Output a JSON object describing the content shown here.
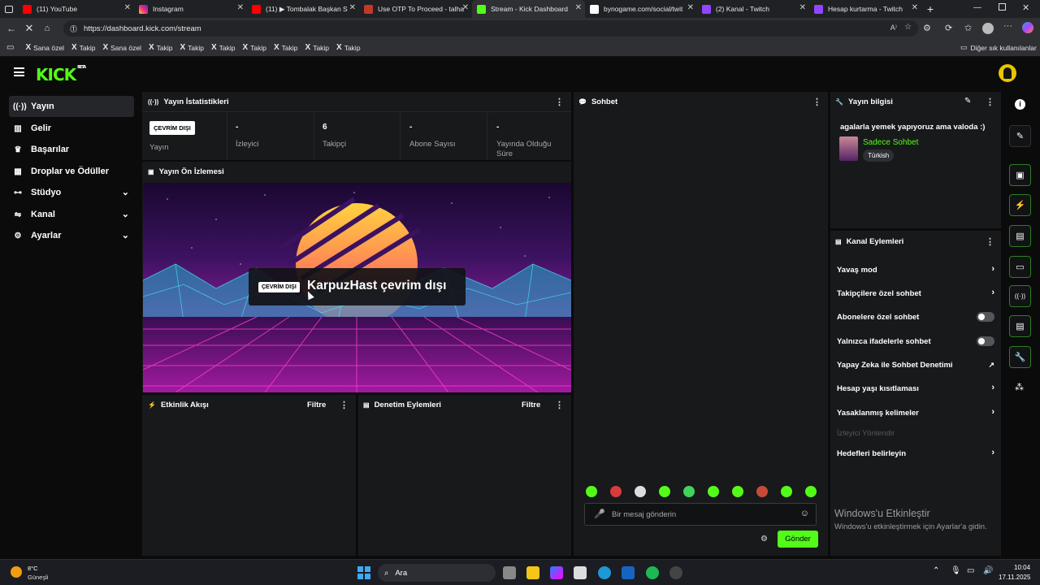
{
  "browser": {
    "tabs": [
      {
        "title": "(11) YouTube",
        "color": "#ff0000"
      },
      {
        "title": "Instagram",
        "color": "#d62976"
      },
      {
        "title": "(11) ▶ Tombalak Başkan S",
        "color": "#ff0000"
      },
      {
        "title": "Use OTP To Proceed - talha",
        "color": "#c0392b"
      },
      {
        "title": "Stream - Kick Dashboard",
        "color": "#53fc18"
      },
      {
        "title": "bynogame.com/social/twit",
        "color": "#ffffff"
      },
      {
        "title": "(2) Kanal - Twitch",
        "color": "#9146ff"
      },
      {
        "title": "Hesap kurtarma - Twitch",
        "color": "#9146ff"
      }
    ],
    "url": "https://dashboard.kick.com/stream",
    "bookmarks": [
      "Sana özel",
      "Takip",
      "Sana özel",
      "Takip",
      "Takip",
      "Takip",
      "Takip",
      "Takip",
      "Takip",
      "Takip"
    ],
    "other_bookmarks": "Diğer sık kullanılanlar"
  },
  "sidebar": {
    "items": [
      {
        "label": "Yayın",
        "icon": "broadcast-icon"
      },
      {
        "label": "Gelir",
        "icon": "revenue-icon"
      },
      {
        "label": "Başarılar",
        "icon": "trophy-icon"
      },
      {
        "label": "Droplar ve Ödüller",
        "icon": "drops-icon"
      },
      {
        "label": "Stüdyo",
        "icon": "studio-icon"
      },
      {
        "label": "Kanal",
        "icon": "channel-icon"
      },
      {
        "label": "Ayarlar",
        "icon": "settings-icon"
      }
    ]
  },
  "stats": {
    "title": "Yayın İstatistikleri",
    "status_badge": "ÇEVRİM DIŞI",
    "status_label": "Yayın",
    "viewers_value": "-",
    "viewers_label": "İzleyici",
    "followers_value": "6",
    "followers_label": "Takipçi",
    "subs_value": "-",
    "subs_label": "Abone Sayısı",
    "uptime_value": "-",
    "uptime_label": "Yayında Olduğu Süre"
  },
  "preview": {
    "title": "Yayın Ön İzlemesi",
    "badge": "ÇEVRİM DIŞI",
    "message": "KarpuzHast çevrim dışı"
  },
  "activity": {
    "title": "Etkinlik Akışı",
    "filter": "Filtre"
  },
  "moderation": {
    "title": "Denetim Eylemleri",
    "filter": "Filtre"
  },
  "chat": {
    "title": "Sohbet",
    "placeholder": "Bir mesaj gönderin",
    "send": "Gönder"
  },
  "stream_info": {
    "title": "Yayın bilgisi",
    "stream_title": "agalarla yemek yapıyoruz ama valoda :)",
    "category": "Sadece Sohbet",
    "language": "Türkish"
  },
  "channel_actions": {
    "title": "Kanal Eylemleri",
    "items": [
      "Yavaş mod",
      "Takipçilere özel sohbet",
      "Abonelere özel sohbet",
      "Yalnızca ifadelerle sohbet",
      "Yapay Zeka ile Sohbet Denetimi",
      "Hesap yaşı kısıtlaması",
      "Yasaklanmış kelimeler"
    ],
    "section": "İzleyici Yönlendir",
    "goals": "Hedefleri belirleyin"
  },
  "watermark": {
    "title": "Windows'u Etkinleştir",
    "subtitle": "Windows'u etkinleştirmek için Ayarlar'a gidin."
  },
  "taskbar": {
    "temp": "8°C",
    "weather": "Güneşli",
    "search": "Ara",
    "time": "10:04",
    "date": "17.11.2025"
  }
}
